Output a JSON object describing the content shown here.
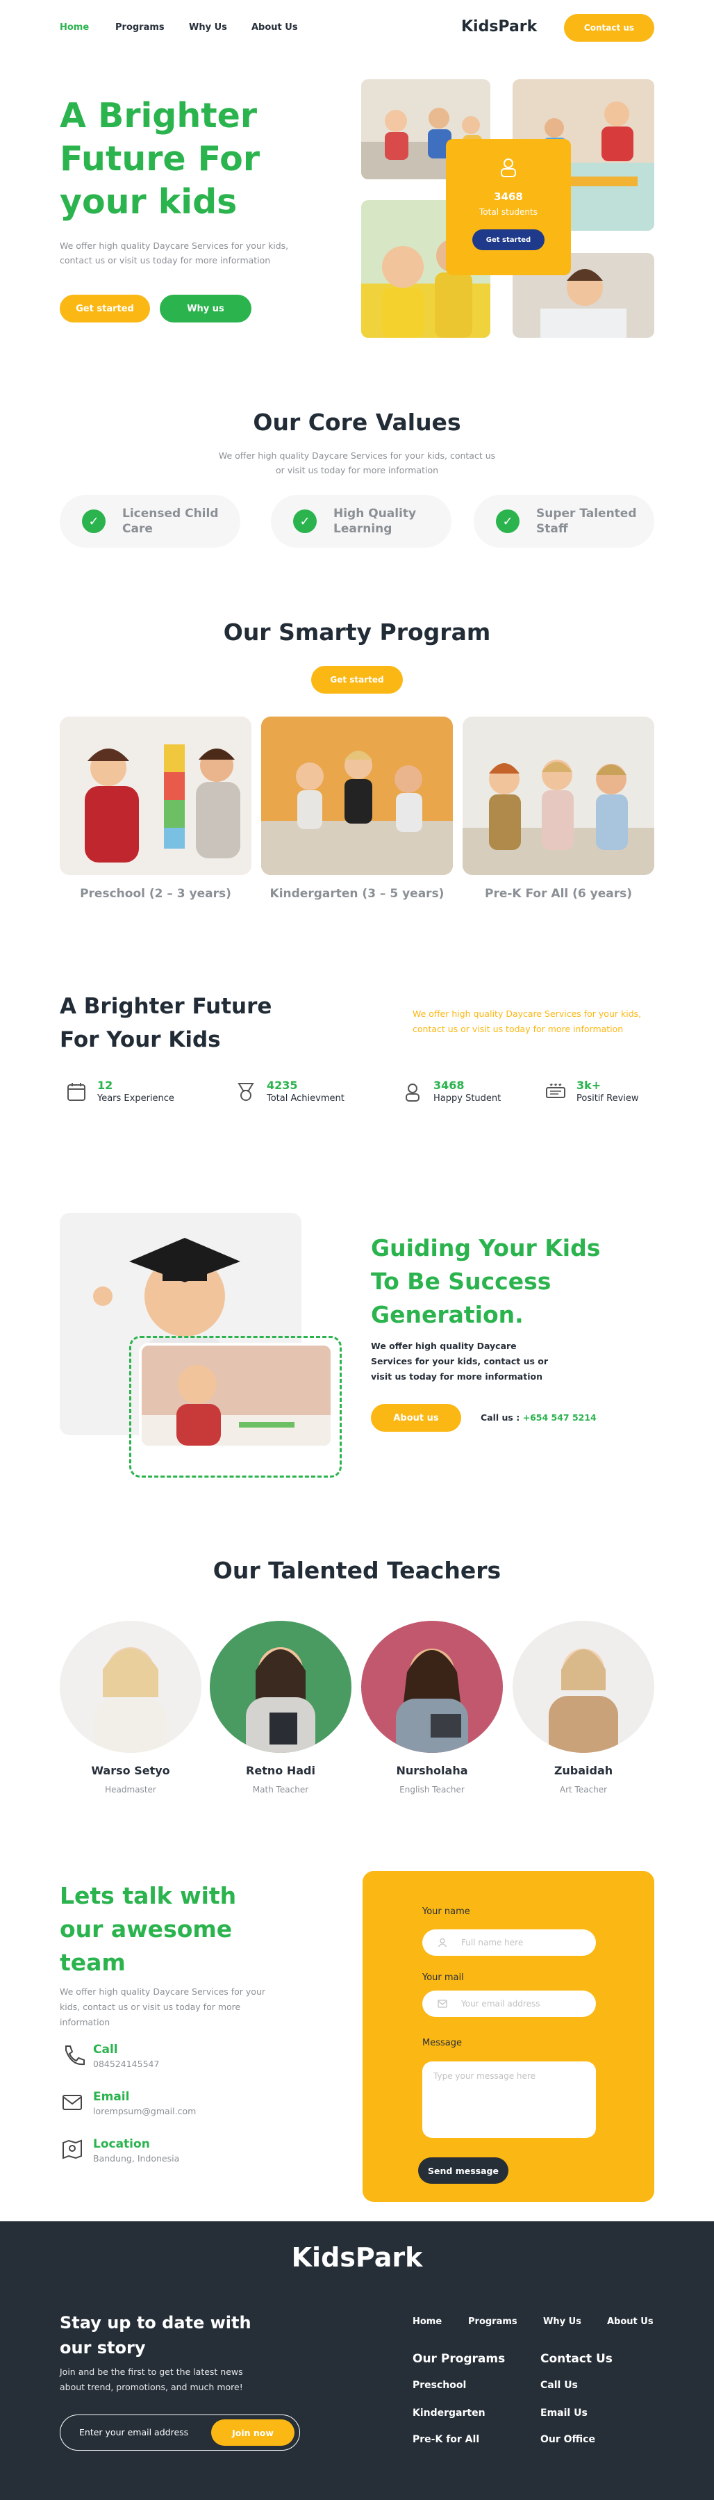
{
  "nav": {
    "items": [
      "Home",
      "Programs",
      "Why Us",
      "About Us"
    ],
    "brand": "KidsPark",
    "contact_button": "Contact us"
  },
  "hero": {
    "title": "A Brighter Future For your kids",
    "subtitle": "We offer high quality Daycare Services for your kids, contact us or visit us today for more information",
    "primary_button": "Get started",
    "secondary_button": "Why us",
    "stat_card": {
      "value": "3468",
      "label": "Total students",
      "button": "Get started"
    }
  },
  "core_values": {
    "title": "Our Core Values",
    "subtitle": "We offer high quality Daycare Services for your kids, contact us or visit us today for more information",
    "items": [
      "Licensed Child Care",
      "High Quality Learning",
      "Super Talented Staff"
    ]
  },
  "program": {
    "title": "Our Smarty Program",
    "button": "Get started",
    "cards": [
      "Preschool (2 – 3 years)",
      "Kindergarten (3 – 5 years)",
      "Pre-K For All (6 years)"
    ]
  },
  "future": {
    "title": "A Brighter Future For Your Kids",
    "subtitle": "We offer high quality Daycare Services for your kids, contact us or visit us today for more information",
    "stats": [
      {
        "value": "12",
        "label": "Years Experience",
        "icon": "calendar-icon"
      },
      {
        "value": "4235",
        "label": "Total Achievment",
        "icon": "medal-icon"
      },
      {
        "value": "3468",
        "label": "Happy Student",
        "icon": "student-icon"
      },
      {
        "value": "3k+",
        "label": "Positif Review",
        "icon": "review-icon"
      }
    ]
  },
  "guiding": {
    "title": "Guiding Your Kids To Be Success Generation.",
    "text": "We offer high quality Daycare Services for your kids, contact us or visit us today for more information",
    "button": "About us",
    "call_label": "Call us :",
    "call_number": "+654 547 5214"
  },
  "teachers": {
    "title": "Our Talented Teachers",
    "items": [
      {
        "name": "Warso Setyo",
        "role": "Headmaster"
      },
      {
        "name": "Retno Hadi",
        "role": "Math Teacher"
      },
      {
        "name": "Nursholaha",
        "role": "English Teacher"
      },
      {
        "name": "Zubaidah",
        "role": "Art Teacher"
      }
    ]
  },
  "contact": {
    "title": "Lets talk with our awesome team",
    "subtitle": "We offer high quality Daycare Services for your kids, contact us or visit us today for more information",
    "call": {
      "label": "Call",
      "value": "084524145547"
    },
    "email": {
      "label": "Email",
      "value": "lorempsum@gmail.com"
    },
    "location": {
      "label": "Location",
      "value": "Bandung, Indonesia"
    },
    "form": {
      "name_label": "Your name",
      "name_placeholder": "Full name here",
      "mail_label": "Your mail",
      "mail_placeholder": "Your email address",
      "message_label": "Message",
      "message_placeholder": "Type your message here",
      "submit": "Send message"
    }
  },
  "footer": {
    "brand": "KidsPark",
    "title": "Stay up to date with our story",
    "text": "Join and be the first to get the latest news about trend, promotions, and much more!",
    "email_placeholder": "Enter your email address",
    "join_button": "Join now",
    "nav": [
      "Home",
      "Programs",
      "Why Us",
      "About Us"
    ],
    "programs_title": "Our Programs",
    "programs": [
      "Preschool",
      "Kindergarten",
      "Pre-K for All"
    ],
    "contact_title": "Contact Us",
    "contact": [
      "Call Us",
      "Email Us",
      "Our Office"
    ]
  },
  "colors": {
    "green": "#2bb34e",
    "yellow": "#fbb713",
    "dark": "#262f38",
    "navy": "#1f3a8a"
  }
}
